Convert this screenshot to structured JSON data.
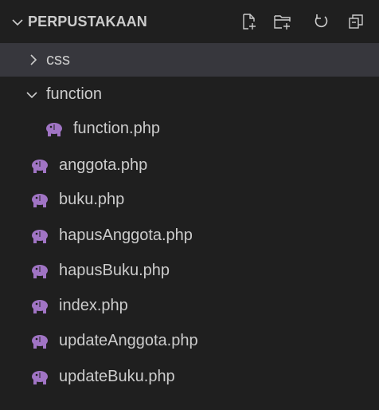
{
  "explorer": {
    "title": "PERPUSTAKAAN",
    "actions": [
      {
        "name": "new-file-icon"
      },
      {
        "name": "new-folder-icon"
      },
      {
        "name": "refresh-icon"
      },
      {
        "name": "collapse-all-icon"
      }
    ],
    "folders": {
      "css": {
        "label": "css",
        "expanded": false
      },
      "function": {
        "label": "function",
        "expanded": true
      }
    },
    "nested_files": [
      {
        "label": "function.php"
      }
    ],
    "files": [
      {
        "label": "anggota.php"
      },
      {
        "label": "buku.php"
      },
      {
        "label": "hapusAnggota.php"
      },
      {
        "label": "hapusBuku.php"
      },
      {
        "label": "index.php"
      },
      {
        "label": "updateAnggota.php"
      },
      {
        "label": "updateBuku.php"
      }
    ],
    "colors": {
      "background": "#1f1f1f",
      "selected_row": "#37373d",
      "text": "#cccccc",
      "php_icon": "#a074c4"
    }
  }
}
